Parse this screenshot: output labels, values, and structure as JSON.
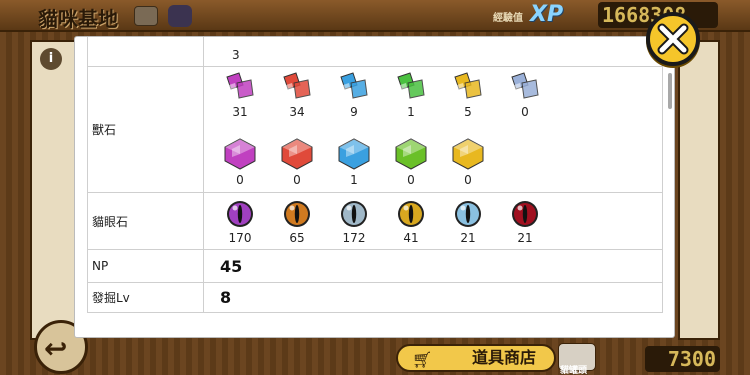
{
  "background": {
    "title": "貓咪基地",
    "xp_label": "經驗值",
    "xp_logo": "XP",
    "xp_value": "1668308",
    "shop_label": "道具商店",
    "catfood_label": "貓罐頭",
    "catfood_value": "7300",
    "info_icon": "i"
  },
  "modal": {
    "previous_row_value": "3",
    "beast_stone": {
      "label": "獸石",
      "small": [
        {
          "icon": "purple-stone-icon",
          "color": "#c040c0",
          "count": "31"
        },
        {
          "icon": "red-stone-icon",
          "color": "#e04a3a",
          "count": "34"
        },
        {
          "icon": "blue-stone-icon",
          "color": "#3aa0e0",
          "count": "9"
        },
        {
          "icon": "green-stone-icon",
          "color": "#4ac040",
          "count": "1"
        },
        {
          "icon": "yellow-stone-icon",
          "color": "#e8b820",
          "count": "5"
        },
        {
          "icon": "rainbow-stone-icon",
          "color": "#9ab0d8",
          "count": "0"
        }
      ],
      "large": [
        {
          "icon": "purple-gem-icon",
          "color": "#c040c0",
          "count": "0"
        },
        {
          "icon": "red-gem-icon",
          "color": "#e04a3a",
          "count": "0"
        },
        {
          "icon": "blue-gem-icon",
          "color": "#3aa0e0",
          "count": "1"
        },
        {
          "icon": "green-gem-icon",
          "color": "#6ac028",
          "count": "0"
        },
        {
          "icon": "yellow-gem-icon",
          "color": "#e8b820",
          "count": "0"
        }
      ]
    },
    "cat_eye": {
      "label": "貓眼石",
      "items": [
        {
          "icon": "purple-cat-eye-icon",
          "color": "#a040c0",
          "count": "170"
        },
        {
          "icon": "orange-cat-eye-icon",
          "color": "#d07a20",
          "count": "65"
        },
        {
          "icon": "silver-cat-eye-icon",
          "color": "#a0b8c8",
          "count": "172"
        },
        {
          "icon": "gold-cat-eye-icon",
          "color": "#d8a820",
          "count": "41"
        },
        {
          "icon": "rainbow-cat-eye-icon",
          "color": "#8ac0e0",
          "count": "21"
        },
        {
          "icon": "dark-cat-eye-icon",
          "color": "#a01020",
          "count": "21"
        }
      ]
    },
    "np": {
      "label": "NP",
      "value": "45"
    },
    "dig_level": {
      "label": "發掘Lv",
      "value": "8"
    }
  }
}
